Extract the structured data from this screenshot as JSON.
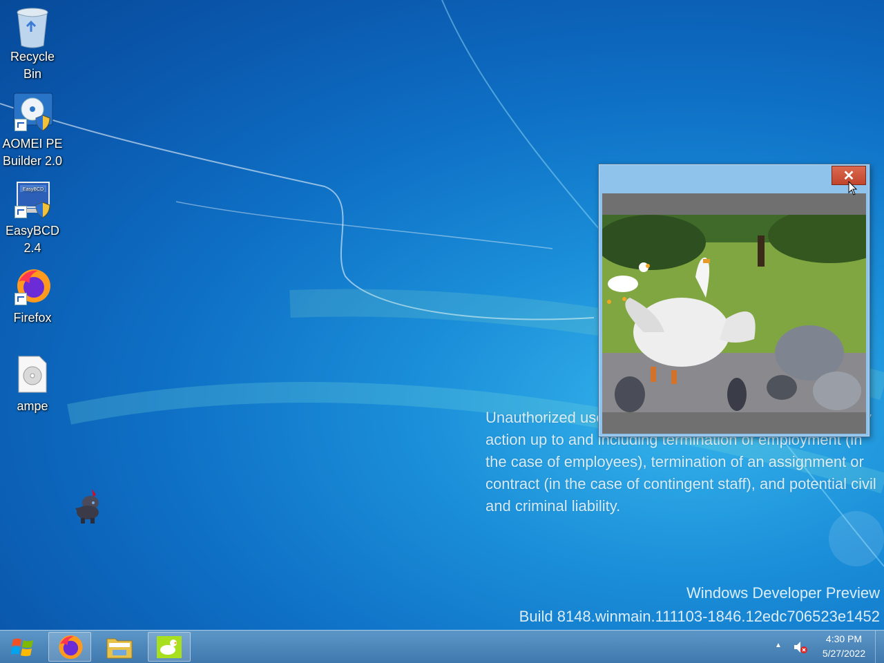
{
  "desktop": {
    "icons": [
      {
        "label_line1": "Recycle",
        "label_line2": "Bin",
        "icon": "recycle-bin-icon"
      },
      {
        "label_line1": "AOMEI PE",
        "label_line2": "Builder 2.0",
        "icon": "aomei-disc-icon"
      },
      {
        "label_line1": "EasyBCD",
        "label_line2": "2.4",
        "icon": "easybcd-icon",
        "badge": "EasyBCD"
      },
      {
        "label_line1": "Firefox",
        "label_line2": "",
        "icon": "firefox-icon"
      },
      {
        "label_line1": "ampe",
        "label_line2": "",
        "icon": "disc-image-file-icon"
      }
    ],
    "pet_icon": "desktop-pet-sprite-icon"
  },
  "watermark": {
    "legal_text": "Unauthorized use of this system may result in disciplinary action up to and including termination of employment (in the case of employees), termination of an assignment or contract (in the case of contingent staff), and potential civil and criminal liability.",
    "edition": "Windows Developer Preview",
    "build": "Build 8148.winmain.111103-1846.12edc706523e1452"
  },
  "popup": {
    "close_label": "✕",
    "content": "goose video"
  },
  "taskbar": {
    "start_icon": "windows-start-icon",
    "pinned": [
      "firefox-icon",
      "file-explorer-icon",
      "goose-app-icon"
    ],
    "tray_arrow": "▲",
    "clock_time": "4:30 PM",
    "clock_date": "5/27/2022"
  },
  "colors": {
    "taskbar": "#4a86bb",
    "close_button": "#c94f35",
    "popup_frame": "#8fc3ec"
  }
}
